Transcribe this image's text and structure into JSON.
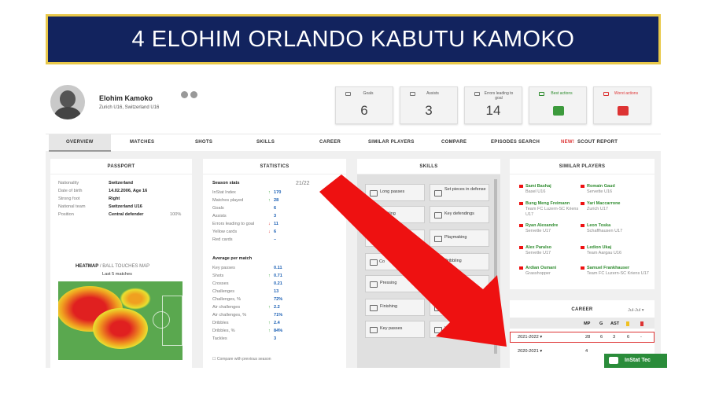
{
  "banner": {
    "title": "4 ELOHIM ORLANDO KABUTU KAMOKO"
  },
  "player": {
    "name": "Elohim Kamoko",
    "clubs": "Zurich U16,  Switzerland U16"
  },
  "stat_boxes": [
    {
      "label": "Goals",
      "value": "6"
    },
    {
      "label": "Assists",
      "value": "3"
    },
    {
      "label": "Errors leading to goal",
      "value": "14"
    },
    {
      "label": "Best actions",
      "value": ""
    },
    {
      "label": "Worst actions",
      "value": ""
    }
  ],
  "tabs": [
    "OVERVIEW",
    "MATCHES",
    "SHOTS",
    "SKILLS",
    "CAREER",
    "SIMILAR PLAYERS",
    "COMPARE",
    "EPISODES SEARCH",
    "NEW!",
    "SCOUT REPORT"
  ],
  "passport": {
    "title": "PASSPORT",
    "rows": [
      {
        "k": "Nationality",
        "v": "Switzerland",
        "x": ""
      },
      {
        "k": "Date of birth",
        "v": "14.02.2006, Age 16",
        "x": ""
      },
      {
        "k": "Strong foot",
        "v": "Right",
        "x": ""
      },
      {
        "k": "National team",
        "v": "Switzerland U16",
        "x": ""
      },
      {
        "k": "Position",
        "v": "Central defender",
        "x": "100%"
      }
    ],
    "heatmap_title": "HEATMAP",
    "heatmap_alt": "/ BALL TOUCHES MAP",
    "heatmap_sub": "Last 5 matches"
  },
  "statistics": {
    "title": "STATISTICS",
    "season_label": "Season stats",
    "season": "21/22",
    "rows": [
      {
        "k": "InStat Index",
        "arrow": "↑",
        "dir": "up",
        "v": "170"
      },
      {
        "k": "Matches played",
        "arrow": "↑",
        "dir": "up",
        "v": "28"
      },
      {
        "k": "Goals",
        "arrow": "",
        "dir": "",
        "v": "6"
      },
      {
        "k": "Assists",
        "arrow": "",
        "dir": "",
        "v": "3"
      },
      {
        "k": "Errors leading to goal",
        "arrow": "↓",
        "dir": "dn",
        "v": "11"
      },
      {
        "k": "Yellow cards",
        "arrow": "↓",
        "dir": "dn",
        "v": "6"
      },
      {
        "k": "Red cards",
        "arrow": "",
        "dir": "",
        "v": "–"
      }
    ],
    "avg_label": "Average per match",
    "avg_rows": [
      {
        "k": "Key passes",
        "arrow": "",
        "dir": "",
        "v": "0.11"
      },
      {
        "k": "Shots",
        "arrow": "↑",
        "dir": "up",
        "v": "0.71"
      },
      {
        "k": "Crosses",
        "arrow": "",
        "dir": "",
        "v": "0.21"
      },
      {
        "k": "Challenges",
        "arrow": "",
        "dir": "",
        "v": "13"
      },
      {
        "k": "Challenges, %",
        "arrow": "",
        "dir": "",
        "v": "72%"
      },
      {
        "k": "Air challenges",
        "arrow": "↑",
        "dir": "up",
        "v": "2.2"
      },
      {
        "k": "Air challenges, %",
        "arrow": "",
        "dir": "",
        "v": "71%"
      },
      {
        "k": "Dribbles",
        "arrow": "↑",
        "dir": "up",
        "v": "2.4"
      },
      {
        "k": "Dribbles, %",
        "arrow": "↑",
        "dir": "up",
        "v": "84%"
      },
      {
        "k": "Tackles",
        "arrow": "",
        "dir": "",
        "v": "3"
      }
    ],
    "compare": "Compare with previous season"
  },
  "skills": {
    "title": "SKILLS",
    "left": [
      "Long passes",
      "Tackling",
      "",
      "",
      "Pressing",
      "Finishing",
      "Key passes"
    ],
    "left_partial": "Co",
    "right": [
      "Set pieces in defense",
      "Key defendings",
      "Playmaking",
      "Dribbling",
      "",
      "Th",
      "Headers"
    ]
  },
  "similar": {
    "title": "SIMILAR PLAYERS",
    "players": [
      {
        "name": "Sami Bashaj",
        "club": "Basel U16"
      },
      {
        "name": "Romain Gaud",
        "club": "Servette U16"
      },
      {
        "name": "Bung Meng Freimann",
        "club": "Team FC Luzern-SC Kriens U17"
      },
      {
        "name": "Yari Maccarrone",
        "club": "Zurich U17"
      },
      {
        "name": "Ryan Alexandre",
        "club": "Servette U17"
      },
      {
        "name": "Leon Toska",
        "club": "Schaffhausen U17"
      },
      {
        "name": "Alex Paralso",
        "club": "Servette U17"
      },
      {
        "name": "Ledion Ukaj",
        "club": "Team Aargau U16"
      },
      {
        "name": "Ardian Osmani",
        "club": "Grasshopper"
      },
      {
        "name": "Samuel Frankhauser",
        "club": "Team FC Luzern-SC Kriens U17"
      }
    ]
  },
  "career": {
    "title": "CAREER",
    "filter": "Jul-Jul ▾",
    "headers": [
      "MP",
      "G",
      "AST",
      "",
      ""
    ],
    "rows": [
      {
        "season": "2021-2022",
        "mp": "28",
        "g": "6",
        "ast": "3",
        "y": "6",
        "r": "-"
      },
      {
        "season": "2020-2021",
        "mp": "4",
        "g": "",
        "ast": "",
        "y": "",
        "r": ""
      }
    ]
  },
  "chat": {
    "label": "InStat Tec"
  },
  "colors": {
    "banner": "#12235e",
    "banner_border": "#e8c84a",
    "arrow": "#ee1111",
    "accent_green": "#2e8b2e",
    "link_blue": "#1a5fb4"
  }
}
